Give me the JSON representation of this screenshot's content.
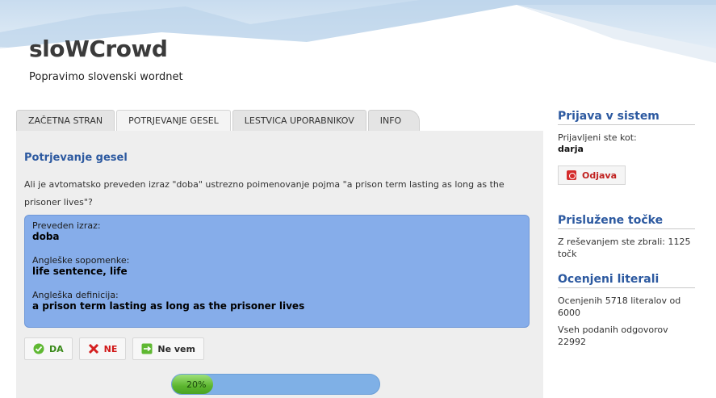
{
  "header": {
    "title": "sloWCrowd",
    "subtitle": "Popravimo slovenski wordnet"
  },
  "tabs": [
    {
      "label": "ZAČETNA STRAN",
      "active": false
    },
    {
      "label": "POTRJEVANJE GESEL",
      "active": true
    },
    {
      "label": "LESTVICA UPORABNIKOV",
      "active": false
    },
    {
      "label": "INFO",
      "active": false
    }
  ],
  "main": {
    "heading": "Potrjevanje gesel",
    "question": "Ali je avtomatsko preveden izraz \"doba\" ustrezno poimenovanje pojma \"a prison term lasting as long as the prisoner lives\"?",
    "info": {
      "translated_label": "Preveden izraz:",
      "translated_value": "doba",
      "synonyms_label": "Angleške sopomenke:",
      "synonyms_value": "life sentence, life",
      "definition_label": "Angleška definicija:",
      "definition_value": "a prison term lasting as long as the prisoner lives"
    },
    "buttons": {
      "yes": "DA",
      "no": "NE",
      "unknown": "Ne vem"
    },
    "progress": {
      "value": 0.2,
      "label": "20%"
    }
  },
  "sidebar": {
    "login_heading": "Prijava v sistem",
    "logged_in_as": "Prijavljeni ste kot:",
    "username": "darja",
    "logout_label": "Odjava",
    "points_heading": "Prislužene točke",
    "points_text": "Z reševanjem ste zbrali: 1125 točk",
    "literals_heading": "Ocenjeni literali",
    "literals_text": "Ocenjenih 5718 literalov od 6000",
    "answers_text": "Vseh podanih odgovorov 22992"
  },
  "colors": {
    "accent": "#2c59a0",
    "info_box": "#86adea",
    "progress_fill": "#5cb52f",
    "progress_track": "#7fb0e6",
    "danger": "#c0211f"
  }
}
